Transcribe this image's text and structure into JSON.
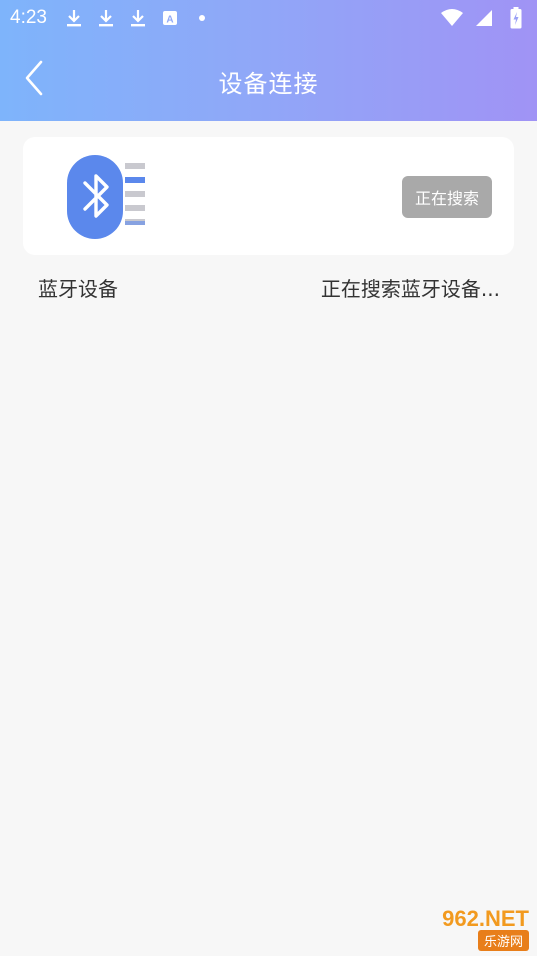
{
  "status_bar": {
    "time": "4:23",
    "icons": [
      "download-icon",
      "download-icon",
      "download-icon",
      "keyboard-a-icon",
      "dot-icon"
    ],
    "right_icons": [
      "wifi-icon",
      "signal-icon",
      "battery-charging-icon"
    ]
  },
  "header": {
    "title": "设备连接",
    "back_icon": "chevron-left-icon"
  },
  "device_card": {
    "icon": "bluetooth-icon",
    "button_label": "正在搜索"
  },
  "bluetooth_row": {
    "label": "蓝牙设备",
    "status": "正在搜索蓝牙设备..."
  },
  "watermark": {
    "top": "962.NET",
    "bottom": "乐游网"
  },
  "colors": {
    "header_gradient_start": "#7eb4fb",
    "header_gradient_end": "#a093f5",
    "bluetooth_blue": "#5b88ec",
    "button_gray": "#a9a9a9"
  }
}
